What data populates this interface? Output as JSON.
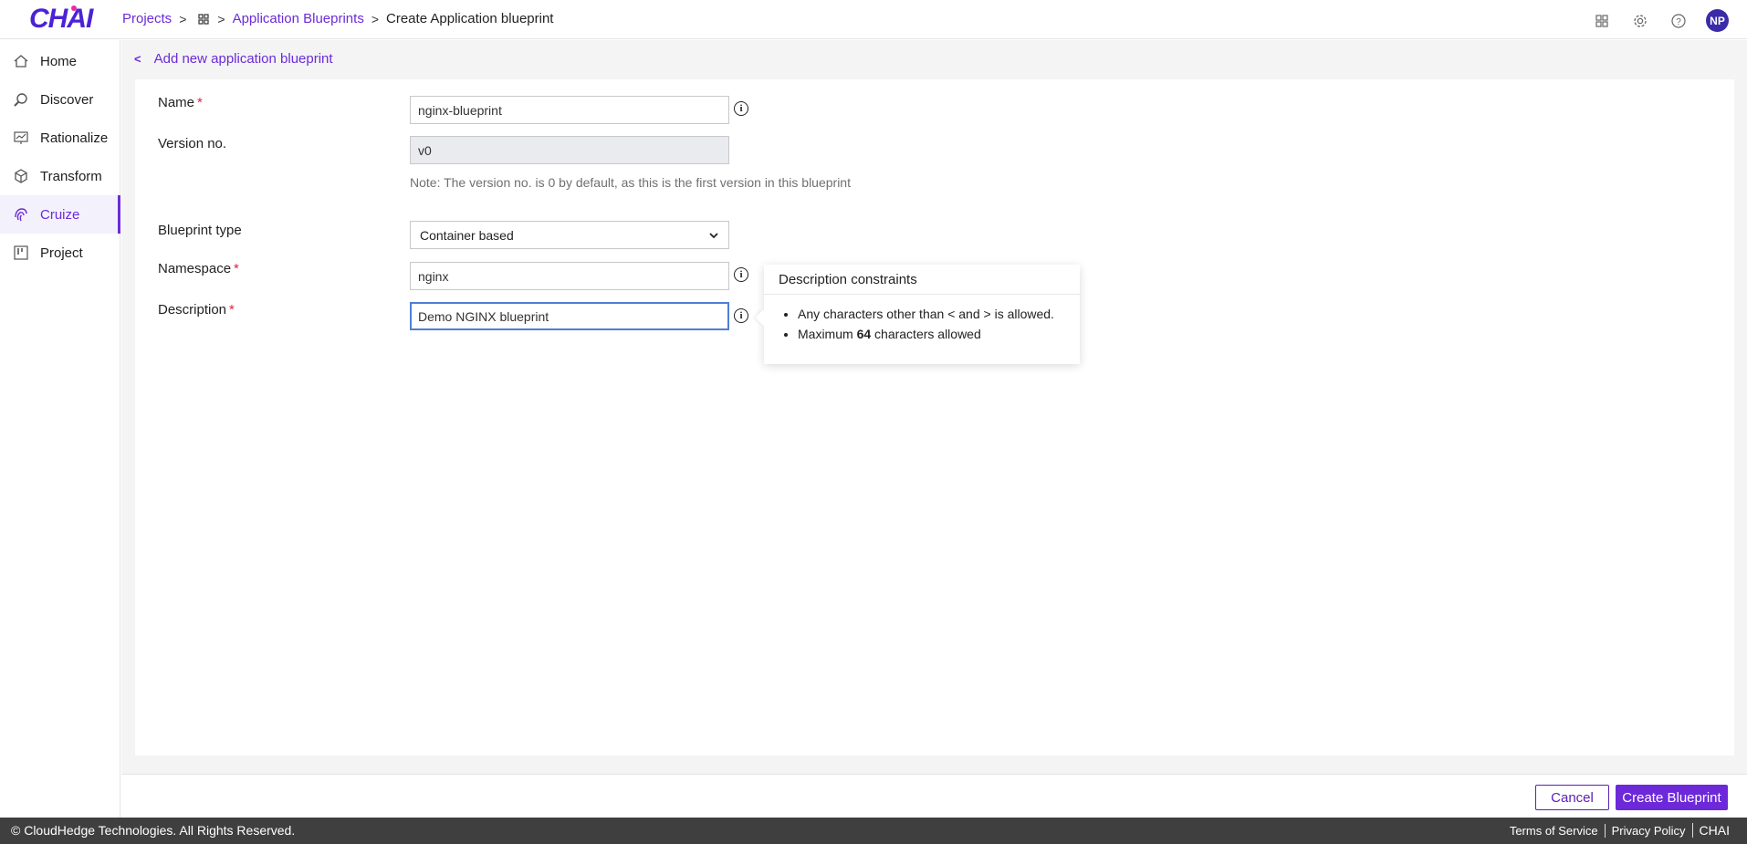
{
  "app": {
    "logo": "CHAI"
  },
  "breadcrumb": {
    "projects": "Projects",
    "blueprints": "Application Blueprints",
    "current": "Create Application blueprint"
  },
  "user": {
    "initials": "NP"
  },
  "sidebar": {
    "items": [
      {
        "label": "Home",
        "icon": "home-icon"
      },
      {
        "label": "Discover",
        "icon": "discover-icon"
      },
      {
        "label": "Rationalize",
        "icon": "rationalize-icon"
      },
      {
        "label": "Transform",
        "icon": "cube-icon"
      },
      {
        "label": "Cruize",
        "icon": "fingerprint-icon",
        "active": true
      },
      {
        "label": "Project",
        "icon": "kanban-icon"
      }
    ]
  },
  "page": {
    "back_label": "Add new application blueprint"
  },
  "form": {
    "name": {
      "label": "Name",
      "value": "nginx-blueprint"
    },
    "version": {
      "label": "Version no.",
      "value": "v0",
      "note": "Note: The version no. is 0 by default, as this is the first version in this blueprint"
    },
    "blueprint_type": {
      "label": "Blueprint type",
      "value": "Container based"
    },
    "namespace": {
      "label": "Namespace",
      "value": "nginx"
    },
    "description": {
      "label": "Description",
      "value": "Demo NGINX blueprint"
    }
  },
  "tooltip": {
    "title": "Description constraints",
    "line1": "Any characters other than < and > is allowed.",
    "line2_prefix": "Maximum ",
    "line2_bold": "64",
    "line2_suffix": " characters allowed"
  },
  "actions": {
    "cancel": "Cancel",
    "create": "Create Blueprint"
  },
  "footer": {
    "copyright": "© CloudHedge Technologies. All Rights Reserved.",
    "terms": "Terms of Service",
    "privacy": "Privacy Policy",
    "brand": "CHAI"
  },
  "colors": {
    "accent": "#6c2bd9",
    "footer_bg": "#3f3f3f",
    "avatar_bg": "#3a2ca8",
    "required": "#e11d48"
  }
}
